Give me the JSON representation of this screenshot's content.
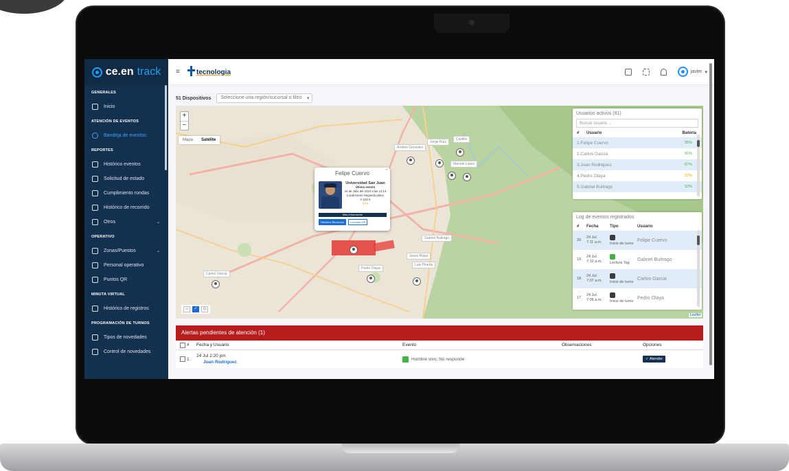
{
  "brand": {
    "name_a": "ce.en",
    "name_b": "track"
  },
  "company_logo": "tecnologia",
  "sidebar": {
    "sections": [
      {
        "label": "GENERALES",
        "items": [
          {
            "label": "Inicio",
            "icon": "home-icon"
          }
        ]
      },
      {
        "label": "ATENCIÓN DE EVENTOS",
        "items": [
          {
            "label": "Bandeja de eventos",
            "icon": "pin-icon",
            "active": true
          }
        ]
      },
      {
        "label": "REPORTES",
        "items": [
          {
            "label": "Histórico eventos",
            "icon": "table-icon"
          },
          {
            "label": "Solicitud de estado",
            "icon": "request-icon"
          },
          {
            "label": "Cumplimiento rondas",
            "icon": "map-icon"
          },
          {
            "label": "Histórico de recorrido",
            "icon": "route-icon"
          },
          {
            "label": "Otros",
            "icon": "list-icon",
            "chevron": true
          }
        ]
      },
      {
        "label": "OPERATIVO",
        "items": [
          {
            "label": "Zonas/Puestos",
            "icon": "zones-icon",
            "chevron": true
          },
          {
            "label": "Personal operativo",
            "icon": "people-icon"
          },
          {
            "label": "Puntos QR",
            "icon": "qr-icon"
          }
        ]
      },
      {
        "label": "MINUTA VIRTUAL",
        "items": [
          {
            "label": "Histórico de registros",
            "icon": "laptop-icon"
          }
        ]
      },
      {
        "label": "PROGRAMACIÓN DE TURNOS",
        "items": [
          {
            "label": "Tipos de novedades",
            "icon": "settings-icon"
          },
          {
            "label": "Control de novedades",
            "icon": "calendar-icon"
          }
        ]
      }
    ]
  },
  "topbar": {
    "user": "javier"
  },
  "filter": {
    "devices": "51 Dispositivos",
    "region_placeholder": "Seleccione una región/sucursal o filtro"
  },
  "map": {
    "map_tab": "Mapa",
    "satellite_tab": "Satélite",
    "attribution": "Leaflet",
    "labels": [
      "Andres Gonzalez",
      "Jorge Ruiz",
      "Castillo",
      "Manuel Lopez",
      "Gabriel Buitrago",
      "Jesus Rojas",
      "Luis Pineda",
      "Pedro Olaya",
      "Carlos Garcia"
    ]
  },
  "popup": {
    "name": "Felipe Cuervo",
    "org": "Universidad San Juan",
    "last_event_label": "Último evento",
    "date": "24 de Julio del 2024 a las 14:13",
    "location": "Localización Segundo plano",
    "version": "V 122.0",
    "battery": "27%",
    "more_info": "Más información",
    "btn_history": "Histórico Recorrido",
    "btn_reads": "Lecturas QR"
  },
  "users_panel": {
    "title": "Usuarios activos (81)",
    "search_placeholder": "Buscar usuario ...",
    "col_num": "#",
    "col_user": "Usuario",
    "col_battery": "Batería",
    "rows": [
      {
        "name": "1.Felipe Cuervo",
        "battery": "95%",
        "color": "#43b244"
      },
      {
        "name": "2.Carlos Garcia",
        "battery": "91%",
        "color": "#43b244"
      },
      {
        "name": "3.Juan Rodriguez",
        "battery": "87%",
        "color": "#43b244"
      },
      {
        "name": "4.Pedro Olaya",
        "battery": "22%",
        "color": "#e8a400"
      },
      {
        "name": "5.Gabriel Buitrago",
        "battery": "52%",
        "color": "#43b244"
      }
    ]
  },
  "events_panel": {
    "title": "Log de eventos registrados",
    "col_num": "#",
    "col_date": "Fecha",
    "col_type": "Tipo",
    "col_user": "Usuario",
    "rows": [
      {
        "num": "20",
        "date": "24 Jul",
        "time": "7:11 a.m.",
        "type": "Inicio de turno",
        "user": "Felipe Cuervo",
        "green": false
      },
      {
        "num": "19",
        "date": "24 Jul",
        "time": "7:12 a.m.",
        "type": "Lectura Tag",
        "user": "Gabriel Buitrago",
        "green": true
      },
      {
        "num": "18",
        "date": "24 Jul",
        "time": "7:07 a.m.",
        "type": "Inicio de turno",
        "user": "Carlos Garcia",
        "green": false
      },
      {
        "num": "17",
        "date": "24 Jul",
        "time": "7:06 a.m.",
        "type": "Inicio de turno",
        "user": "Pedro Olaya",
        "green": false
      }
    ]
  },
  "alerts": {
    "title": "Alertas pendientes de atención (1)",
    "col_num": "#",
    "col_date_user": "Fecha y Usuario",
    "col_event": "Evento",
    "col_obs": "Observaciones",
    "col_options": "Opciones",
    "rows": [
      {
        "num": "1",
        "date": "24 Jul 2:20 pm",
        "user": "Juan Rodriguez",
        "event": "Hombre vivo: No responde",
        "action": "Atender"
      }
    ]
  }
}
